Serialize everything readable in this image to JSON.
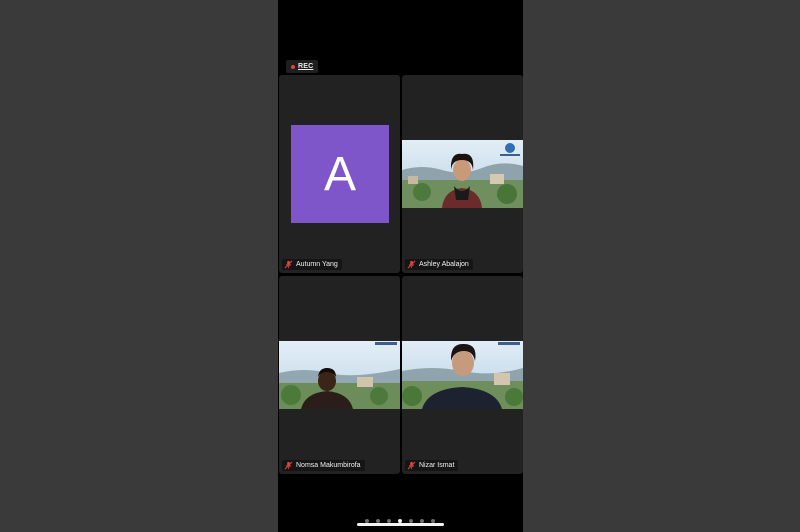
{
  "recording": {
    "label": "REC"
  },
  "participants": [
    {
      "name": "Autumn Yang",
      "avatar_letter": "A",
      "avatar_color": "#7f56c9",
      "muted": true
    },
    {
      "name": "Ashley Abalajon",
      "muted": true
    },
    {
      "name": "Nomsa Makumbirofa",
      "muted": true
    },
    {
      "name": "Nizar Ismat",
      "muted": true
    }
  ],
  "pagination": {
    "page_count": 7,
    "active_page": 4
  },
  "colors": {
    "muted_icon": "#e0443c",
    "tile_bg": "#222222",
    "app_bg": "#000000"
  }
}
